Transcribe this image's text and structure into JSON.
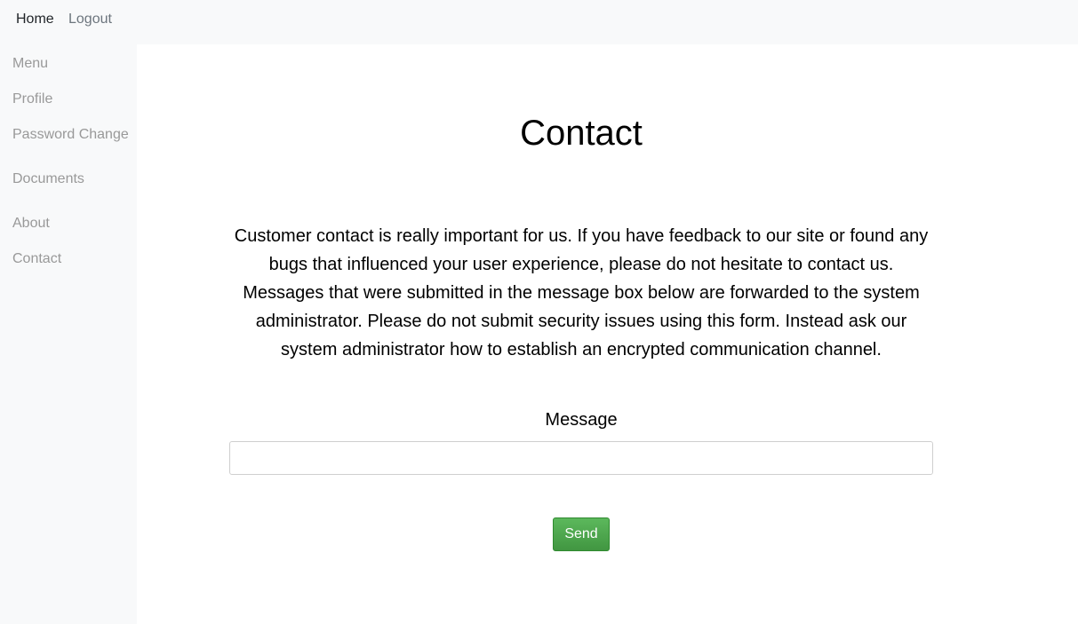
{
  "topnav": {
    "home_label": "Home",
    "logout_label": "Logout"
  },
  "sidebar": {
    "items": [
      {
        "label": "Menu"
      },
      {
        "label": "Profile"
      },
      {
        "label": "Password Change"
      },
      {
        "label": "Documents"
      },
      {
        "label": "About"
      },
      {
        "label": "Contact"
      }
    ]
  },
  "main": {
    "title": "Contact",
    "intro": "Customer contact is really important for us. If you have feedback to our site or found any bugs that influenced your user experience, please do not hesitate to contact us. Messages that were submitted in the message box below are forwarded to the system administrator. Please do not submit security issues using this form. Instead ask our system administrator how to establish an encrypted communication channel.",
    "message_label": "Message",
    "message_value": "",
    "send_label": "Send"
  },
  "colors": {
    "nav_background": "#f8f9fa",
    "muted_text": "#999999",
    "send_button": "#4cae4c"
  }
}
